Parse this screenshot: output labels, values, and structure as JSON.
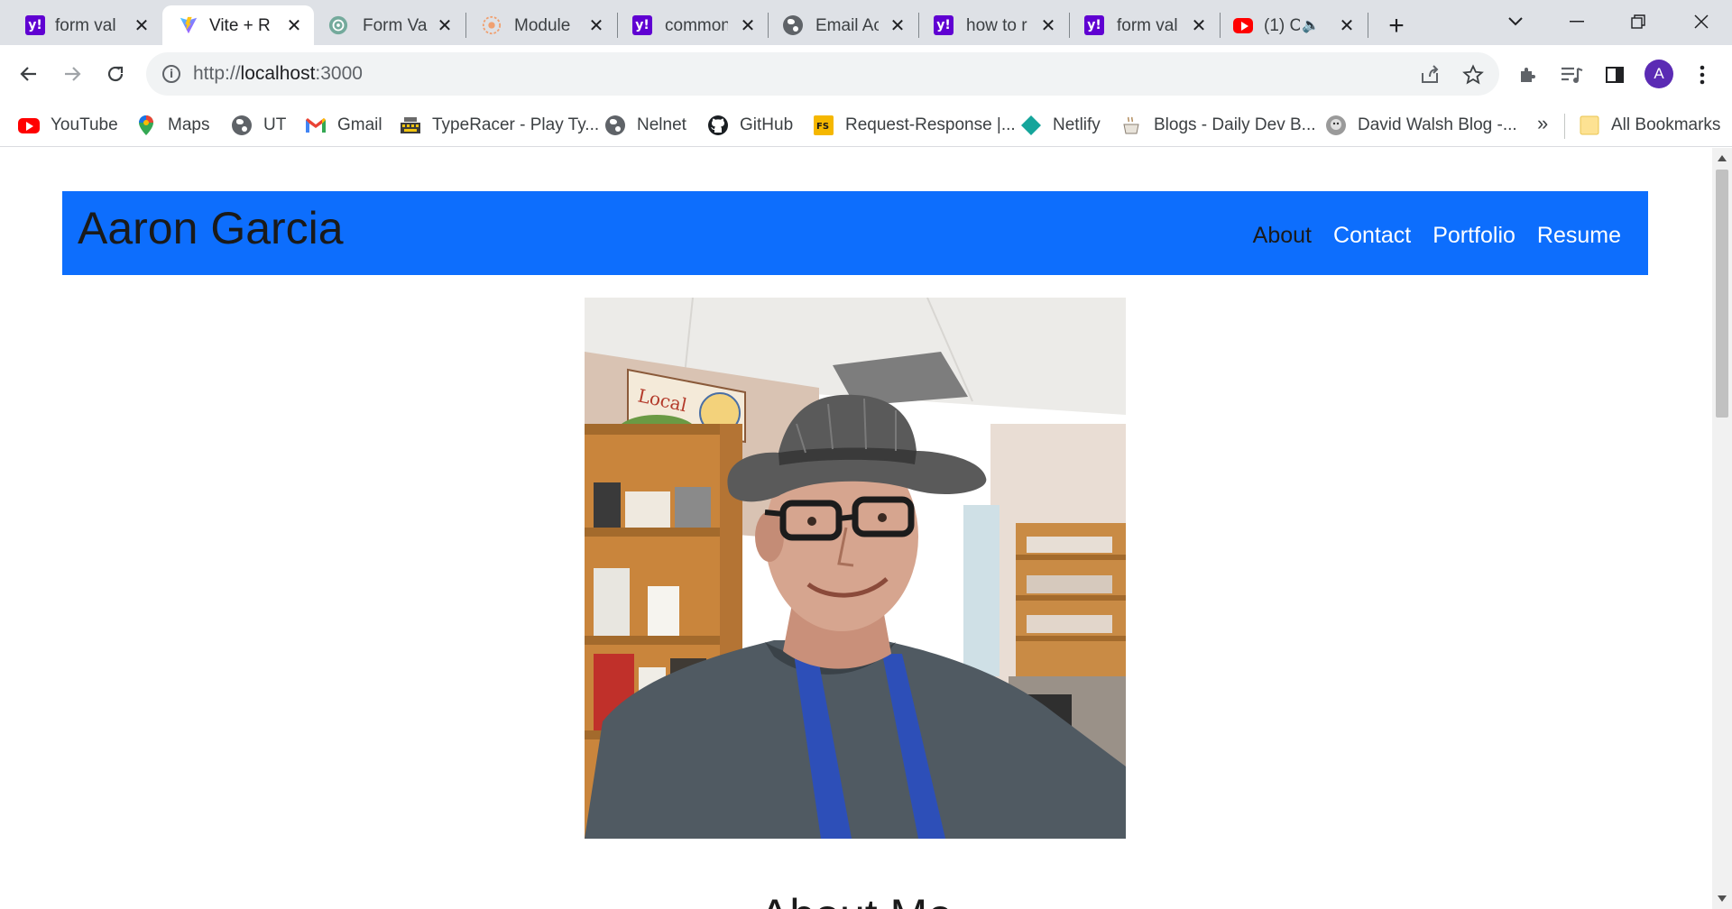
{
  "browser": {
    "tabs": [
      {
        "title": "form val",
        "favicon": "yahoo-icon",
        "active": false
      },
      {
        "title": "Vite + R",
        "favicon": "vite-icon",
        "active": true
      },
      {
        "title": "Form Va",
        "favicon": "chatgpt-icon",
        "active": false
      },
      {
        "title": "Module",
        "favicon": "module-icon",
        "active": false
      },
      {
        "title": "common",
        "favicon": "yahoo-icon",
        "active": false
      },
      {
        "title": "Email Ac",
        "favicon": "globe-icon",
        "active": false
      },
      {
        "title": "how to r",
        "favicon": "yahoo-icon",
        "active": false
      },
      {
        "title": "form val",
        "favicon": "yahoo-icon",
        "active": false
      },
      {
        "title": "(1) C",
        "favicon": "youtube-icon",
        "active": false,
        "audio": true
      }
    ],
    "address": {
      "prefix": "http://",
      "host": "localhost",
      "port": ":3000"
    },
    "profile_initial": "A",
    "bookmarks": [
      {
        "label": "YouTube",
        "icon": "youtube-icon"
      },
      {
        "label": "Maps",
        "icon": "maps-icon"
      },
      {
        "label": "UT",
        "icon": "globe-icon"
      },
      {
        "label": "Gmail",
        "icon": "gmail-icon"
      },
      {
        "label": "TypeRacer - Play Ty...",
        "icon": "typeracer-icon"
      },
      {
        "label": "Nelnet",
        "icon": "globe-icon"
      },
      {
        "label": "GitHub",
        "icon": "github-icon"
      },
      {
        "label": "Request-Response |...",
        "icon": "fs-icon"
      },
      {
        "label": "Netlify",
        "icon": "netlify-icon"
      },
      {
        "label": "Blogs - Daily Dev B...",
        "icon": "coffee-icon"
      },
      {
        "label": "David Walsh Blog -...",
        "icon": "davidwalsh-icon"
      }
    ],
    "more_bookmarks": "»",
    "all_bookmarks": "All Bookmarks"
  },
  "page": {
    "brand": "Aaron Garcia",
    "nav": [
      {
        "label": "About",
        "current": true
      },
      {
        "label": "Contact",
        "current": false
      },
      {
        "label": "Portfolio",
        "current": false
      },
      {
        "label": "Resume",
        "current": false
      }
    ],
    "section_heading": "About Me"
  },
  "colors": {
    "navbar": "#0d6efd",
    "tabstrip": "#dee1e6",
    "yahoo": "#6001d2"
  }
}
